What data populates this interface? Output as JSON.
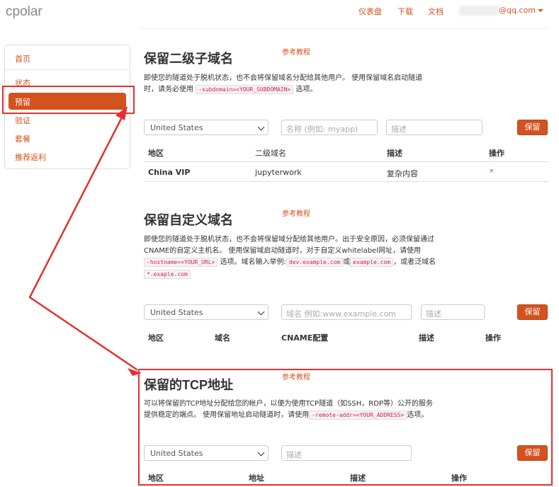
{
  "app": {
    "logo": "cpolar"
  },
  "topnav": {
    "dashboard": "仪表盘",
    "download": "下载",
    "docs": "文档",
    "email": "@qq.com"
  },
  "sidebar": {
    "items": [
      {
        "label": "首页"
      },
      {
        "label": "状态"
      },
      {
        "label": "预留"
      },
      {
        "label": "验证"
      },
      {
        "label": "套餐"
      },
      {
        "label": "推荐返利"
      }
    ],
    "active_index": 2
  },
  "sections": {
    "subdomain": {
      "title": "保留二级子域名",
      "tutorial": "参考教程",
      "desc_1": "即使您的隧道处于脱机状态，也不会将保留域名分配给其他用户。 使用保留域名启动隧道",
      "desc_2a": "时，请务必使用",
      "desc_code": "-subdomain=<YOUR_SUBDOMAIN>",
      "desc_2b": "选项。",
      "region": "United States",
      "name_placeholder": "名称 (例如: myapp)",
      "desc_placeholder": "描述",
      "button": "保留",
      "columns": [
        "地区",
        "二级域名",
        "描述",
        "操作"
      ],
      "rows": [
        {
          "region": "China VIP",
          "subdomain": "jupyterwork",
          "description": "复杂内容",
          "action": "×"
        }
      ]
    },
    "custom_domain": {
      "title": "保留自定义域名",
      "tutorial": "参考教程",
      "desc_1": "即使您的隧道处于脱机状态，也不会将保留域分配给其他用户。出于安全原因，必须保留通过",
      "desc_2": "CNAME的自定义主机名。 使用保留域启动隧道时，对于自定义whitelabel网址，请使用",
      "desc_code1": "-hostname=<YOUR_URL>",
      "desc_3a": "选项。域名输入举例:",
      "desc_code2": "dev.example.com",
      "desc_or": "或",
      "desc_code3": "example.com",
      "desc_3b": "，或者泛域名",
      "desc_code4": "*.exaple.com",
      "region": "United States",
      "domain_placeholder": "域名 例如:www.example.com",
      "desc_placeholder": "描述",
      "button": "保留",
      "columns": [
        "地区",
        "域名",
        "CNAME配置",
        "描述",
        "操作"
      ]
    },
    "tcp": {
      "title": "保留的TCP地址",
      "tutorial": "参考教程",
      "desc_1": "可以将保留的TCP地址分配给您的帐户，以便为使用TCP隧道（如SSH，RDP等）公开的服务",
      "desc_2a": "提供稳定的端点。 使用保留地址启动隧道时，请使用",
      "desc_code": "-remote-addr=<YOUR_ADDRESS>",
      "desc_2b": "选项。",
      "region": "United States",
      "desc_placeholder": "描述",
      "button": "保留",
      "columns": [
        "地区",
        "地址",
        "描述",
        "操作"
      ]
    }
  },
  "annotation_color": "#e53030",
  "accent_color": "#d4521e"
}
